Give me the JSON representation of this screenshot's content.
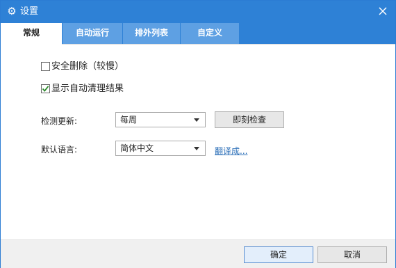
{
  "window": {
    "title": "设置",
    "icon": "gear-icon"
  },
  "tabs": [
    {
      "label": "常规",
      "active": true
    },
    {
      "label": "自动运行",
      "active": false
    },
    {
      "label": "排外列表",
      "active": false
    },
    {
      "label": "自定义",
      "active": false
    }
  ],
  "general": {
    "secure_delete": {
      "label": "安全删除（较慢）",
      "checked": false
    },
    "show_autoclean": {
      "label": "显示自动清理结果",
      "checked": true
    },
    "update_check": {
      "label": "检测更新:",
      "value": "每周",
      "button": "即刻检查"
    },
    "language": {
      "label": "默认语言:",
      "value": "简体中文",
      "link": "翻译成..."
    }
  },
  "footer": {
    "ok": "确定",
    "cancel": "取消"
  },
  "colors": {
    "titlebar": "#2e81d6",
    "tab_inactive": "#5ea0e3",
    "link": "#2c6fb8",
    "checkmark": "#2a8a2a"
  }
}
